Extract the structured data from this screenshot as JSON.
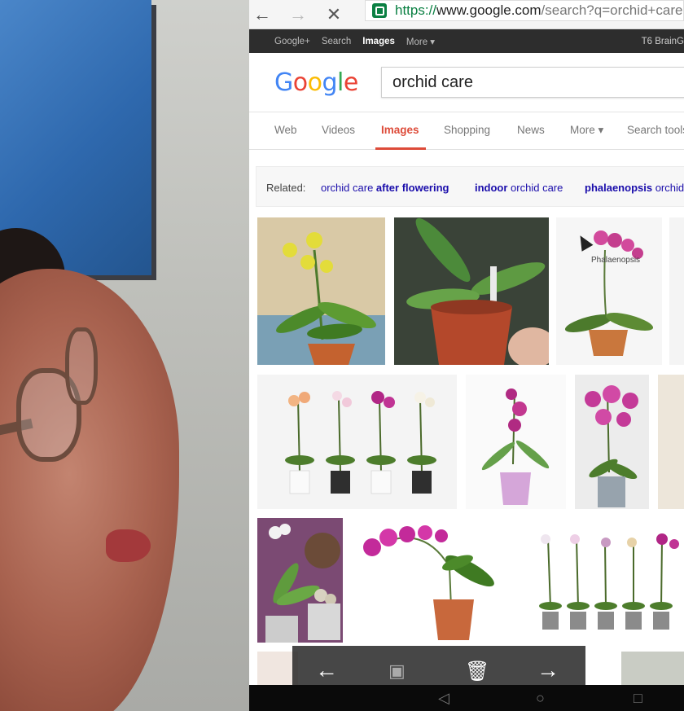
{
  "browser": {
    "url_scheme": "https://",
    "url_host": "www.google.com",
    "url_rest": "/search?q=orchid+care",
    "nav": {
      "back_icon": "arrow-left-icon",
      "forward_icon": "arrow-right-icon",
      "stop_icon": "close-icon",
      "lock_icon": "lock-icon"
    }
  },
  "gbar": {
    "items": [
      "Google+",
      "Search",
      "Images",
      "More ▾"
    ],
    "active": "Images",
    "account": "T6 BrainG"
  },
  "search": {
    "logo": {
      "G": "G",
      "o1": "o",
      "o2": "o",
      "g": "g",
      "l": "l",
      "e": "e"
    },
    "query": "orchid care"
  },
  "tabs": {
    "web": "Web",
    "videos": "Videos",
    "images": "Images",
    "shopping": "Shopping",
    "news": "News",
    "more": "More ▾",
    "search_tools": "Search tools"
  },
  "related": {
    "label": "Related:",
    "r1_plain": "orchid care ",
    "r1_bold": "after flowering",
    "r2_bold": "indoor",
    "r2_plain": " orchid care",
    "r3_bold": "phalaenopsis",
    "r3_plain": " orchid care"
  },
  "image_captions": {
    "phalaenopsis": "Phalaenopsis"
  },
  "overlay": {
    "prev_icon": "arrow-left-icon",
    "cast_icon": "screen-cast-icon",
    "delete_icon": "trash-icon",
    "next_icon": "arrow-right-icon"
  },
  "android_nav": {
    "back_icon": "triangle-back-icon",
    "home_icon": "circle-home-icon",
    "recents_icon": "square-recents-icon"
  },
  "colors": {
    "accent_red": "#dd4b39",
    "link_blue": "#1a0dab",
    "secure_green": "#0b8043"
  }
}
